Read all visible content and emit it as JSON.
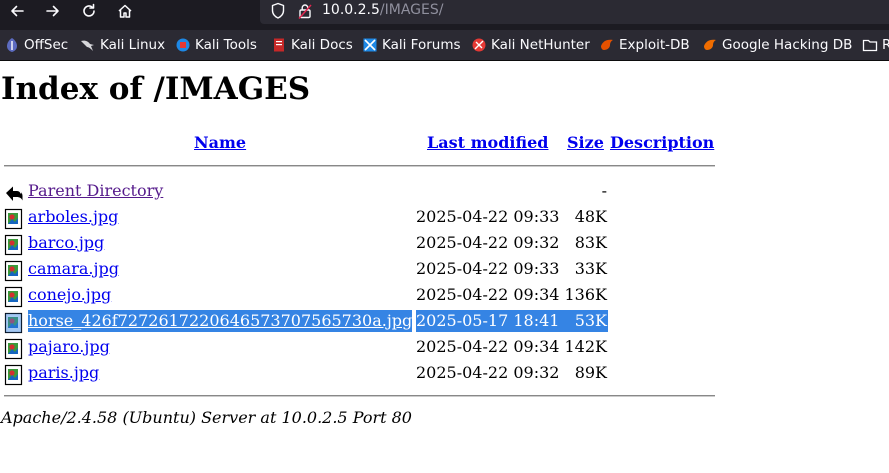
{
  "browser": {
    "url_host": "10.0.2.5",
    "url_path": "/IMAGES/",
    "bookmarks": [
      {
        "label": "OffSec",
        "icon": "offsec-icon",
        "color": "#3f51b5"
      },
      {
        "label": "Kali Linux",
        "icon": "kali-dragon-icon",
        "color": "#2b2a33"
      },
      {
        "label": "Kali Tools",
        "icon": "kali-tools-icon",
        "color": "#e53935"
      },
      {
        "label": "Kali Docs",
        "icon": "kali-docs-icon",
        "color": "#c62828"
      },
      {
        "label": "Kali Forums",
        "icon": "kali-forums-icon",
        "color": "#1e88e5"
      },
      {
        "label": "Kali NetHunter",
        "icon": "kali-nethunter-icon",
        "color": "#e53935"
      },
      {
        "label": "Exploit-DB",
        "icon": "exploit-db-icon",
        "color": "#e65100"
      },
      {
        "label": "Google Hacking DB",
        "icon": "ghdb-icon",
        "color": "#e65100"
      },
      {
        "label": "R",
        "icon": "folder-icon",
        "color": "#fbfbfe"
      }
    ]
  },
  "page": {
    "title": "Index of /IMAGES",
    "columns": {
      "name": "Name",
      "modified": "Last modified",
      "size": "Size",
      "description": "Description"
    },
    "parent": {
      "label": "Parent Directory",
      "size": "-"
    },
    "files": [
      {
        "name": "arboles.jpg",
        "modified": "2025-04-22 09:33",
        "size": "48K"
      },
      {
        "name": "barco.jpg",
        "modified": "2025-04-22 09:32",
        "size": "83K"
      },
      {
        "name": "camara.jpg",
        "modified": "2025-04-22 09:33",
        "size": "33K"
      },
      {
        "name": "conejo.jpg",
        "modified": "2025-04-22 09:34",
        "size": "136K"
      },
      {
        "name": "horse_426f7272617220646573707565730a.jpg",
        "modified": "2025-05-17 18:41",
        "size": "53K",
        "selected": true
      },
      {
        "name": "pajaro.jpg",
        "modified": "2025-04-22 09:34",
        "size": "142K"
      },
      {
        "name": "paris.jpg",
        "modified": "2025-04-22 09:32",
        "size": "89K"
      }
    ],
    "signature": "Apache/2.4.58 (Ubuntu) Server at 10.0.2.5 Port 80"
  },
  "colors": {
    "link": "#0000ee",
    "visited": "#551a8b",
    "selection": "#3584e4",
    "chrome_dark": "#1c1b22",
    "urlbar": "#2b2a33"
  }
}
